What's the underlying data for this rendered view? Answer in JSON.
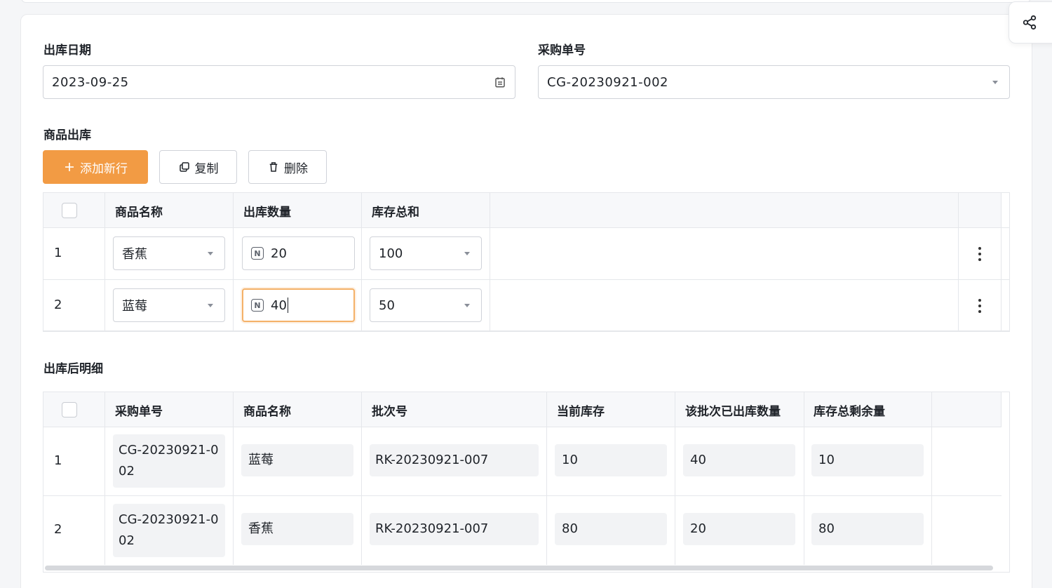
{
  "form": {
    "outbound_date_label": "出库日期",
    "outbound_date_value": "2023-09-25",
    "purchase_no_label": "采购单号",
    "purchase_no_value": "CG-20230921-002"
  },
  "goods_section": {
    "title": "商品出库",
    "buttons": {
      "add": "添加新行",
      "copy": "复制",
      "delete": "删除"
    },
    "columns": [
      "商品名称",
      "出库数量",
      "库存总和"
    ],
    "rows": [
      {
        "index": "1",
        "product": "香蕉",
        "quantity": "20",
        "stock_total": "100"
      },
      {
        "index": "2",
        "product": "蓝莓",
        "quantity": "40",
        "stock_total": "50"
      }
    ]
  },
  "detail_section": {
    "title": "出库后明细",
    "columns": [
      "采购单号",
      "商品名称",
      "批次号",
      "当前库存",
      "该批次已出库数量",
      "库存总剩余量"
    ],
    "rows": [
      {
        "index": "1",
        "purchase_no": "CG-20230921-002",
        "product": "蓝莓",
        "batch": "RK-20230921-007",
        "current": "10",
        "shipped": "40",
        "remaining": "10"
      },
      {
        "index": "2",
        "purchase_no": "CG-20230921-002",
        "product": "香蕉",
        "batch": "RK-20230921-007",
        "current": "80",
        "shipped": "20",
        "remaining": "80"
      }
    ]
  },
  "colors": {
    "accent": "#f29b44",
    "border": "#d0d3d9",
    "readonly_bg": "#f2f3f5"
  }
}
